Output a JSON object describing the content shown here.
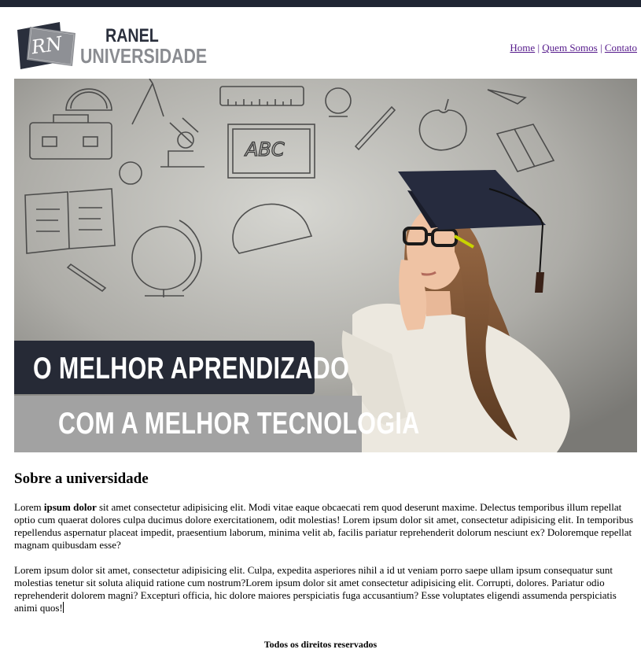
{
  "logo": {
    "monogram": "RN",
    "name": "RANEL",
    "subtitle": "UNIVERSIDADE"
  },
  "nav": {
    "items": [
      "Home",
      "Quem Somos",
      "Contato"
    ],
    "separator": "|"
  },
  "hero": {
    "line1": "O MELHOR APRENDIZADO",
    "line2": "COM A MELHOR TECNOLOGIA",
    "board_text": "ABC"
  },
  "about": {
    "title": "Sobre a universidade",
    "p1_start": "Lorem ",
    "p1_bold": "ipsum dolor",
    "p1_rest": " sit amet consectetur adipisicing elit. Modi vitae eaque obcaecati rem quod deserunt maxime. Delectus temporibus illum repellat optio cum quaerat dolores culpa ducimus dolore exercitationem, odit molestias! Lorem ipsum dolor sit amet, consectetur adipisicing elit. In temporibus repellendus aspernatur placeat impedit, praesentium laborum, minima velit ab, facilis pariatur reprehenderit dolorum nesciunt ex? Doloremque repellat magnam quibusdam esse?",
    "p2": "Lorem ipsum dolor sit amet, consectetur adipisicing elit. Culpa, expedita asperiores nihil a id ut veniam porro saepe ullam ipsum consequatur sunt molestias tenetur sit soluta aliquid ratione cum nostrum?Lorem ipsum dolor sit amet consectetur adipisicing elit. Corrupti, dolores. Pariatur odio reprehenderit dolorem magni? Excepturi officia, hic dolore maiores perspiciatis fuga accusantium? Esse voluptates eligendi assumenda perspiciatis animi quos!"
  },
  "footer": {
    "text": "Todos os direitos reservados"
  },
  "colors": {
    "topbar": "#1f2533",
    "banner_dark": "#262a36",
    "banner_light": "#a2a2a2",
    "link_visited": "#551a8b"
  }
}
